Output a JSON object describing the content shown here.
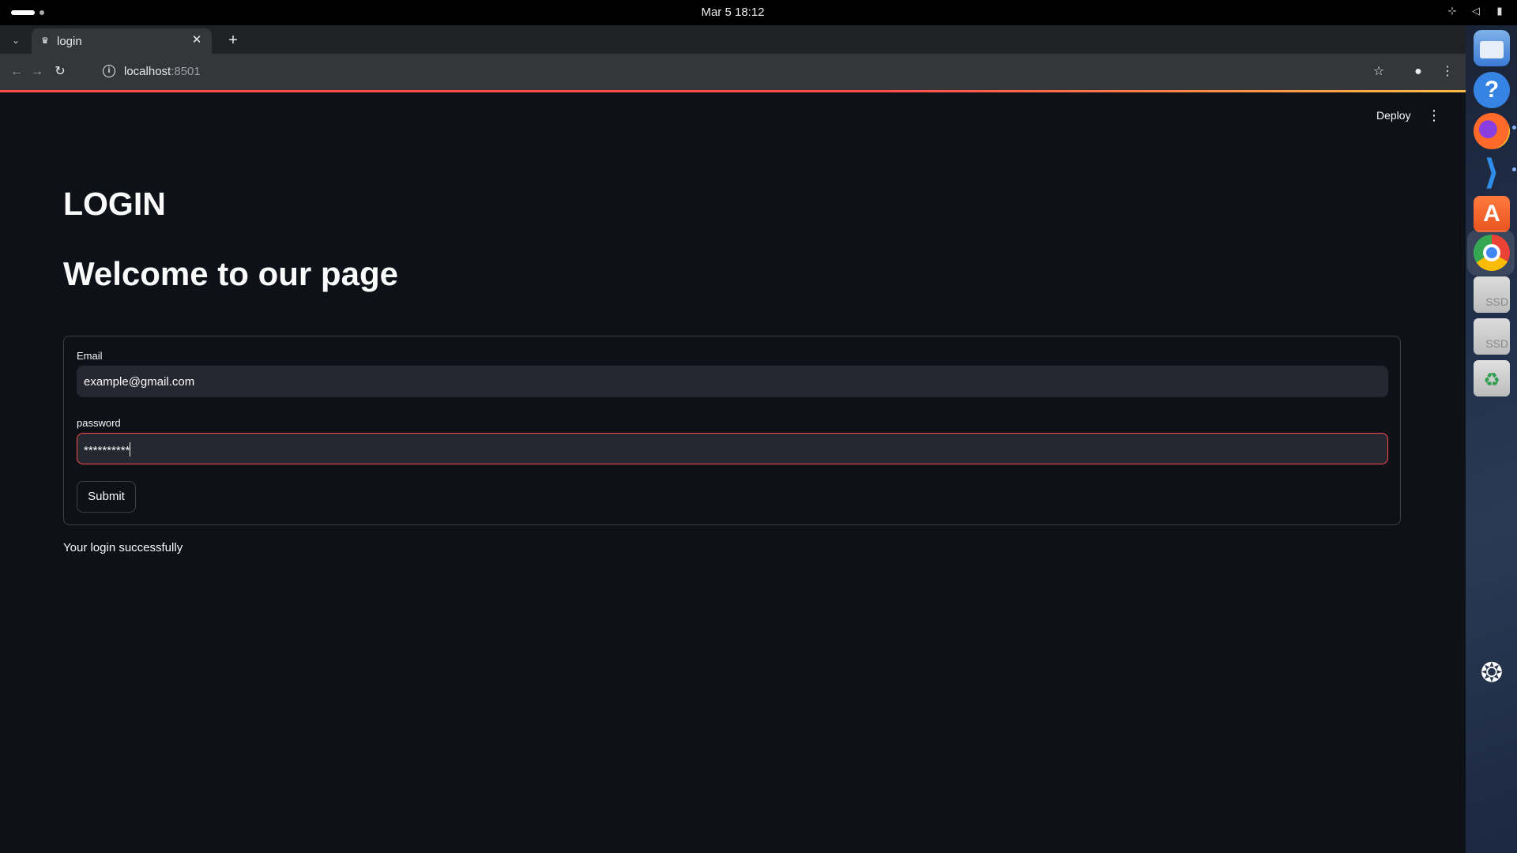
{
  "system": {
    "clock": "Mar 5  18:12",
    "tray_icons": [
      "network-icon",
      "volume-muted-icon",
      "battery-icon"
    ]
  },
  "browser": {
    "tab": {
      "title": "login",
      "favicon": "streamlit-crown-icon"
    },
    "address": {
      "host": "localhost",
      "port": ":8501"
    },
    "icons": [
      "back-icon",
      "forward-icon",
      "reload-icon",
      "site-info-icon",
      "bookmark-star-icon",
      "profile-icon",
      "menu-icon"
    ]
  },
  "app": {
    "header": {
      "deploy_label": "Deploy"
    },
    "title": "LOGIN",
    "subtitle": "Welcome to our page",
    "form": {
      "email_label": "Email",
      "email_value": "example@gmail.com",
      "password_label": "password",
      "password_value": "**********",
      "submit_label": "Submit"
    },
    "message": "Your login successfully",
    "accent_color": "#ff4b4b"
  },
  "dock": {
    "items": [
      "files",
      "help",
      "firefox",
      "vscode",
      "app-center",
      "chrome",
      "ssd",
      "ssd",
      "trash",
      "show-apps"
    ],
    "ssd_label": "SSD"
  }
}
